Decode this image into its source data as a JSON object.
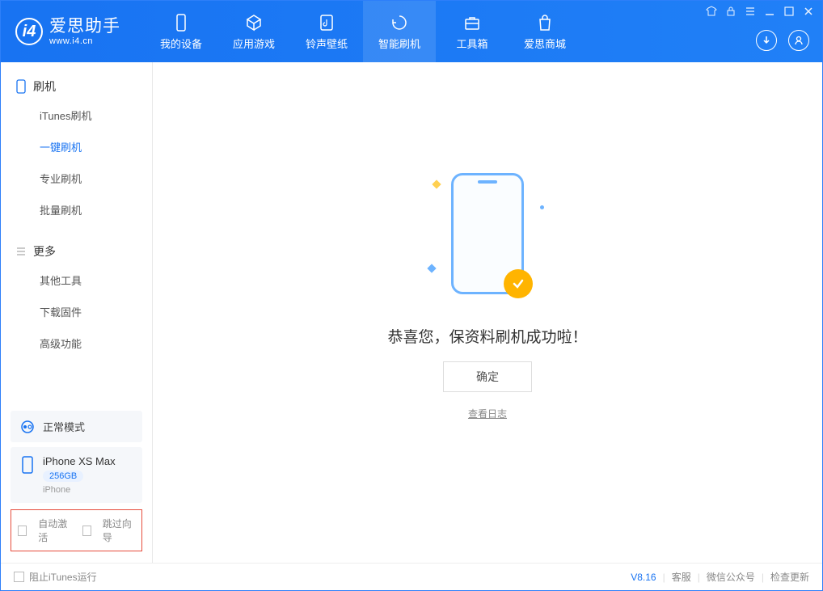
{
  "app": {
    "title": "爱思助手",
    "subtitle": "www.i4.cn"
  },
  "nav": {
    "tabs": [
      {
        "label": "我的设备"
      },
      {
        "label": "应用游戏"
      },
      {
        "label": "铃声壁纸"
      },
      {
        "label": "智能刷机"
      },
      {
        "label": "工具箱"
      },
      {
        "label": "爱思商城"
      }
    ]
  },
  "sidebar": {
    "section1": {
      "title": "刷机",
      "items": [
        "iTunes刷机",
        "一键刷机",
        "专业刷机",
        "批量刷机"
      ]
    },
    "section2": {
      "title": "更多",
      "items": [
        "其他工具",
        "下载固件",
        "高级功能"
      ]
    },
    "mode_box": "正常模式",
    "device": {
      "name": "iPhone XS Max",
      "capacity": "256GB",
      "type": "iPhone"
    },
    "cb1": "自动激活",
    "cb2": "跳过向导"
  },
  "main": {
    "success": "恭喜您，保资料刷机成功啦！",
    "ok": "确定",
    "log": "查看日志"
  },
  "footer": {
    "block_itunes": "阻止iTunes运行",
    "version": "V8.16",
    "link1": "客服",
    "link2": "微信公众号",
    "link3": "检查更新"
  }
}
